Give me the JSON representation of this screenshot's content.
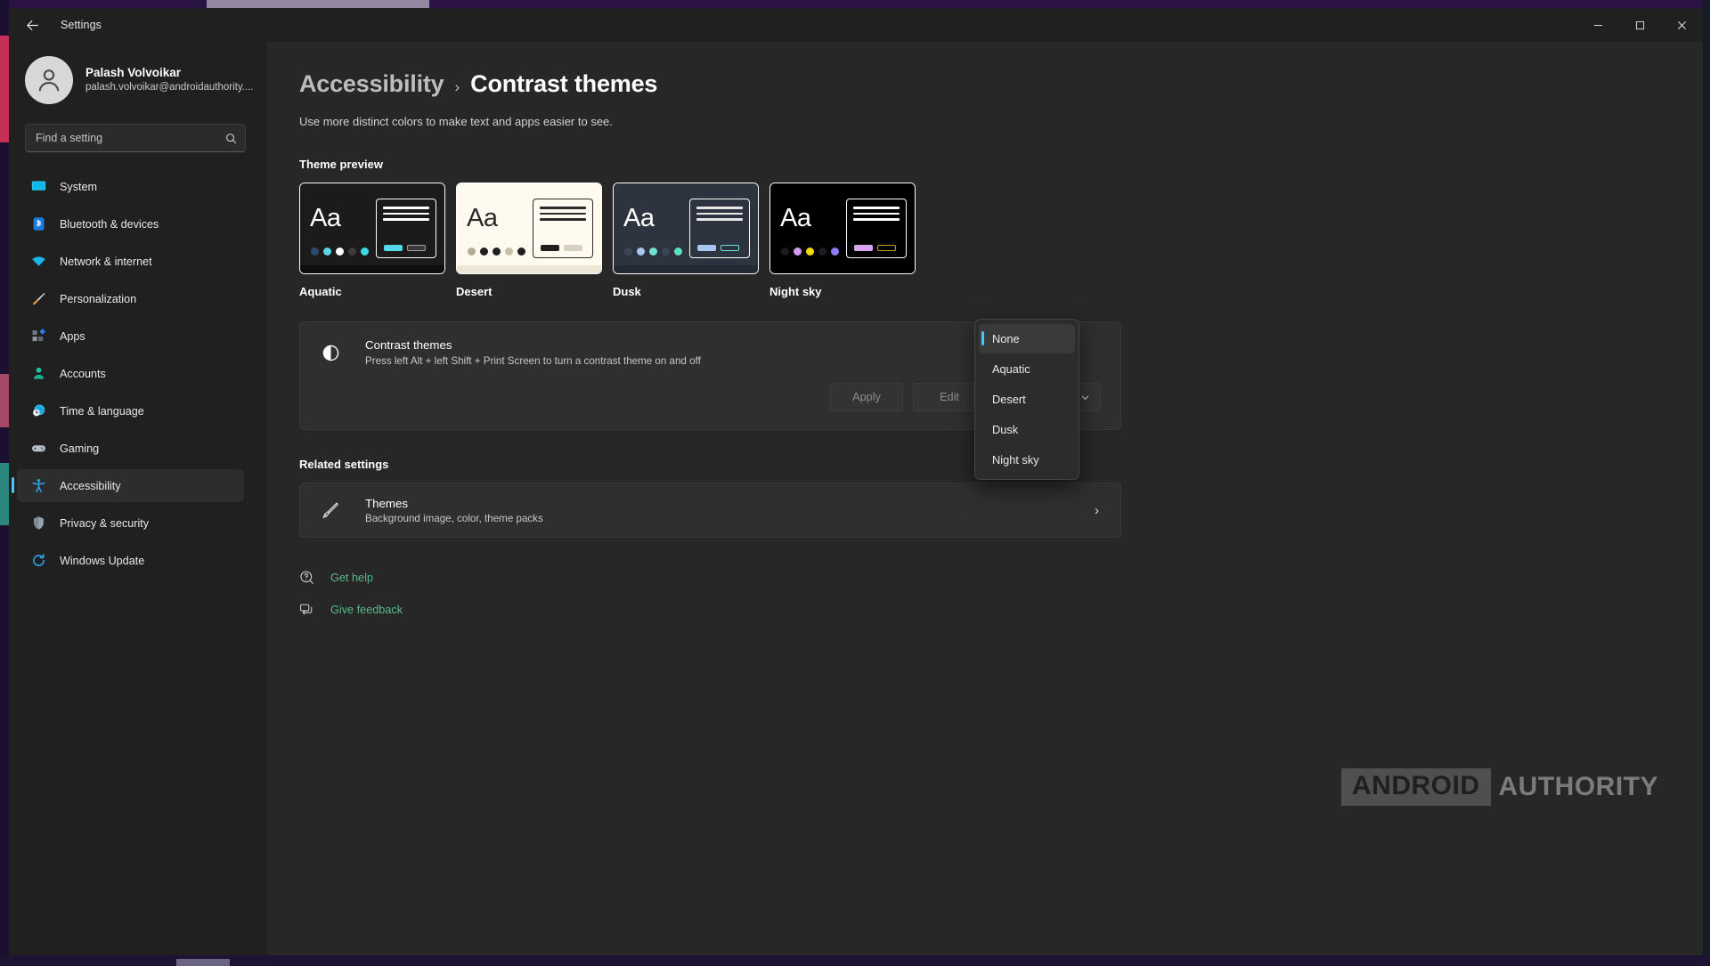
{
  "window": {
    "title": "Settings",
    "back_icon": "back-arrow-icon",
    "minimize_label": "Minimize",
    "maximize_label": "Maximize",
    "close_label": "Close"
  },
  "account": {
    "name": "Palash Volvoikar",
    "email": "palash.volvoikar@androidauthority...."
  },
  "search": {
    "placeholder": "Find a setting",
    "value": ""
  },
  "sidebar": {
    "items": [
      {
        "label": "System",
        "icon": "monitor-icon",
        "selected": false
      },
      {
        "label": "Bluetooth & devices",
        "icon": "bluetooth-icon",
        "selected": false
      },
      {
        "label": "Network & internet",
        "icon": "wifi-icon",
        "selected": false
      },
      {
        "label": "Personalization",
        "icon": "paintbrush-icon",
        "selected": false
      },
      {
        "label": "Apps",
        "icon": "apps-icon",
        "selected": false
      },
      {
        "label": "Accounts",
        "icon": "person-icon",
        "selected": false
      },
      {
        "label": "Time & language",
        "icon": "clock-globe-icon",
        "selected": false
      },
      {
        "label": "Gaming",
        "icon": "gamepad-icon",
        "selected": false
      },
      {
        "label": "Accessibility",
        "icon": "accessibility-icon",
        "selected": true
      },
      {
        "label": "Privacy & security",
        "icon": "shield-icon",
        "selected": false
      },
      {
        "label": "Windows Update",
        "icon": "update-icon",
        "selected": false
      }
    ]
  },
  "page": {
    "breadcrumb_parent": "Accessibility",
    "breadcrumb_separator": "›",
    "breadcrumb_current": "Contrast themes",
    "description": "Use more distinct colors to make text and apps easier to see."
  },
  "theme_preview": {
    "section_label": "Theme preview",
    "cards": [
      {
        "name": "Aquatic",
        "selected": true,
        "bg": "#1b1b1b",
        "text_color": "#ffffff",
        "border": "#ffffff",
        "dots": [
          "#2e4a6b",
          "#56d8e8",
          "#ffffff",
          "#3d3d3d",
          "#3ddbe8"
        ],
        "doc_bg": "#1b1b1b",
        "doc_border": "#ffffff",
        "doc_lines": [
          "#ffffff",
          "#ffffff",
          "#ffffff"
        ],
        "doc_btn_primary": "#53d9ea",
        "doc_btn_secondary": "#3a3a3a",
        "strip": "#0d0d0d"
      },
      {
        "name": "Desert",
        "selected": false,
        "bg": "#fffaef",
        "text_color": "#2b2b2b",
        "border": "#ffffff",
        "dots": [
          "#b5ab99",
          "#1f1f1f",
          "#1f1f1f",
          "#c9c0ae",
          "#1f1f1f"
        ],
        "doc_bg": "#fffaef",
        "doc_border": "#2b2b2b",
        "doc_lines": [
          "#2b2b2b",
          "#2b2b2b",
          "#2b2b2b"
        ],
        "doc_btn_primary": "#1f1f1f",
        "doc_btn_secondary": "#d8d1c0",
        "strip": "#efe7d6"
      },
      {
        "name": "Dusk",
        "selected": false,
        "bg": "#2d3440",
        "text_color": "#ffffff",
        "border": "#ffffff",
        "dots": [
          "#3a4557",
          "#a9c6f0",
          "#6fe3d6",
          "#3a4557",
          "#5ce0c3"
        ],
        "doc_bg": "#2d3440",
        "doc_border": "#ffffff",
        "doc_lines": [
          "#e8e8e8",
          "#e8e8e8",
          "#e8e8e8"
        ],
        "doc_btn_primary": "#a9c6f0",
        "doc_btn_secondary": "#2d3440",
        "strip": "#232a35"
      },
      {
        "name": "Night sky",
        "selected": false,
        "bg": "#000000",
        "text_color": "#ffffff",
        "border": "#ffffff",
        "dots": [
          "#1c1c1c",
          "#cf9cf0",
          "#f5d90a",
          "#1c1c1c",
          "#8f7bf5"
        ],
        "doc_bg": "#000000",
        "doc_border": "#ffffff",
        "doc_lines": [
          "#ffffff",
          "#ffffff",
          "#ffffff"
        ],
        "doc_btn_primary": "#dba5ef",
        "doc_btn_secondary": "#7a6a12",
        "strip": "#000000"
      }
    ]
  },
  "contrast_card": {
    "icon": "contrast-icon",
    "title": "Contrast themes",
    "subtitle": "Press left Alt + left Shift + Print Screen to turn a contrast theme on and off",
    "apply_label": "Apply",
    "edit_label": "Edit",
    "selected_value": "None",
    "chevron_icon": "chevron-down-icon"
  },
  "dropdown": {
    "open": true,
    "options": [
      {
        "label": "None",
        "active": true
      },
      {
        "label": "Aquatic",
        "active": false
      },
      {
        "label": "Desert",
        "active": false
      },
      {
        "label": "Dusk",
        "active": false
      },
      {
        "label": "Night sky",
        "active": false
      }
    ]
  },
  "related": {
    "section_label": "Related settings",
    "items": [
      {
        "icon": "themes-brush-icon",
        "title": "Themes",
        "subtitle": "Background image, color, theme packs",
        "chevron": "›"
      }
    ]
  },
  "footer_links": [
    {
      "label": "Get help",
      "icon": "help-icon"
    },
    {
      "label": "Give feedback",
      "icon": "feedback-icon"
    }
  ],
  "watermark": {
    "box_text": "ANDROID",
    "text": "AUTHORITY"
  },
  "colors": {
    "accent": "#4cc2ff",
    "link": "#5ab98a",
    "content_bg": "#272727",
    "sidebar_bg": "#202020",
    "card_bg": "#2f2f2f"
  }
}
